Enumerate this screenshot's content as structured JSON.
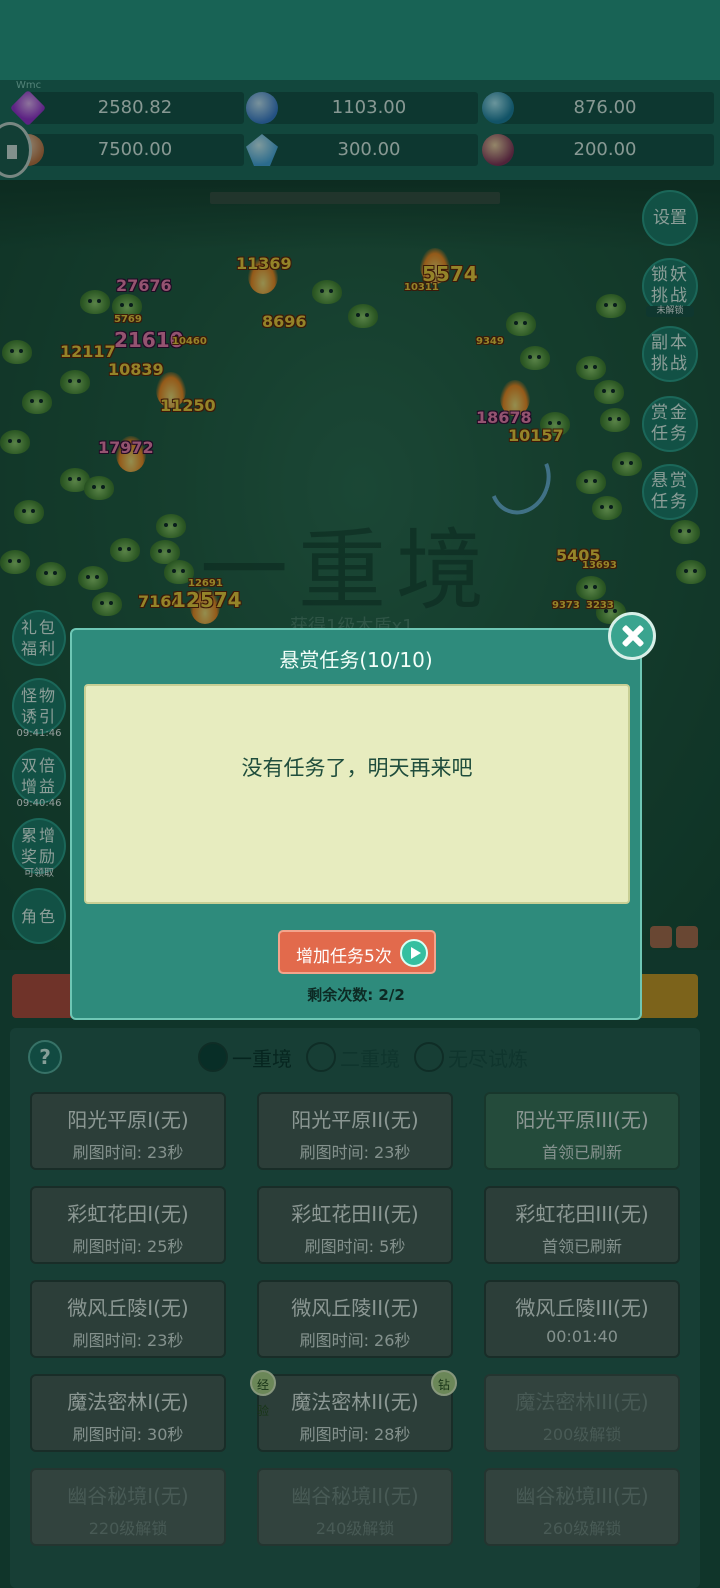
{
  "resources": {
    "header_small": "Wmc",
    "gem": "2580.82",
    "crystal": "1103.00",
    "globe": "876.00",
    "scroll": "7500.00",
    "shard": "300.00",
    "pouch": "200.00"
  },
  "right_buttons": {
    "settings": "设置",
    "lock_demon": "锁妖挑战",
    "lock_demon_sub": "未解锁",
    "dungeon": "副本挑战",
    "bounty": "赏金任务",
    "reward_task": "悬赏任务"
  },
  "left_buttons": {
    "gift": "礼包福利",
    "lure": "怪物诱引",
    "lure_time": "09:41:46",
    "double": "双倍增益",
    "double_time": "09:40:46",
    "accumulate": "累增奖励",
    "accumulate_sub": "可领取",
    "role": "角色"
  },
  "battle": {
    "stage_name": "一重境",
    "reward_text": "获得1级木盾x1",
    "damage": [
      "11369",
      "27676",
      "5574",
      "10311",
      "8696",
      "5769",
      "21610",
      "10460",
      "12117",
      "10839",
      "9349",
      "11250",
      "18678",
      "10157",
      "17972",
      "5405",
      "13693",
      "7164",
      "12574",
      "12691",
      "9373",
      "3233"
    ]
  },
  "modal": {
    "title": "悬赏任务(10/10)",
    "message": "没有任务了，明天再来吧",
    "add_button": "增加任务5次",
    "remaining": "剩余次数: 2/2"
  },
  "panel": {
    "help": "?",
    "tabs": [
      "一重境",
      "二重境",
      "无尽试炼"
    ],
    "stages": [
      {
        "name": "阳光平原I(无)",
        "info": "刷图时间: 23秒"
      },
      {
        "name": "阳光平原II(无)",
        "info": "刷图时间: 23秒"
      },
      {
        "name": "阳光平原III(无)",
        "info": "首领已刷新"
      },
      {
        "name": "彩虹花田I(无)",
        "info": "刷图时间: 25秒"
      },
      {
        "name": "彩虹花田II(无)",
        "info": "刷图时间: 5秒"
      },
      {
        "name": "彩虹花田III(无)",
        "info": "首领已刷新"
      },
      {
        "name": "微风丘陵I(无)",
        "info": "刷图时间: 23秒"
      },
      {
        "name": "微风丘陵II(无)",
        "info": "刷图时间: 26秒"
      },
      {
        "name": "微风丘陵III(无)",
        "info": "00:01:40"
      },
      {
        "name": "魔法密林I(无)",
        "info": "刷图时间: 30秒"
      },
      {
        "name": "魔法密林II(无)",
        "info": "刷图时间: 28秒"
      },
      {
        "name": "魔法密林III(无)",
        "info": "200级解锁"
      },
      {
        "name": "幽谷秘境I(无)",
        "info": "220级解锁"
      },
      {
        "name": "幽谷秘境II(无)",
        "info": "240级解锁"
      },
      {
        "name": "幽谷秘境III(无)",
        "info": "260级解锁"
      }
    ],
    "badge_exp": "经验",
    "badge_diamond": "钻"
  }
}
